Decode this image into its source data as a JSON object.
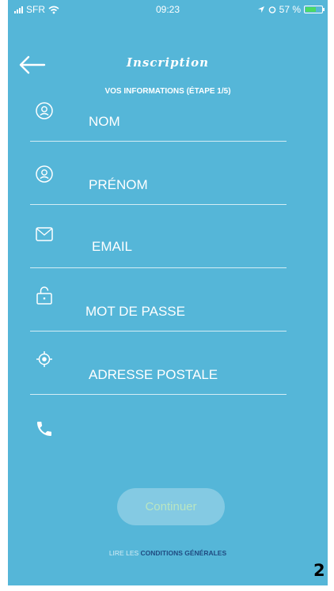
{
  "status_bar": {
    "carrier": "SFR",
    "time": "09:23",
    "battery": "57 %",
    "battery_level": 0.57
  },
  "header": {
    "title": "Inscription",
    "subtitle": "VOS INFORMATIONS (ÉTAPE 1/5)"
  },
  "fields": [
    {
      "label": "NOM",
      "icon": "user-circle-icon"
    },
    {
      "label": "PRÉNOM",
      "icon": "user-circle-icon"
    },
    {
      "label": "EMAIL",
      "icon": "envelope-icon"
    },
    {
      "label": "MOT DE PASSE",
      "icon": "lock-icon"
    },
    {
      "label": "ADRESSE POSTALE",
      "icon": "location-target-icon"
    }
  ],
  "phone_field": {
    "icon": "phone-icon"
  },
  "actions": {
    "continue_label": "Continuer"
  },
  "footer": {
    "lire_les": "LIRE LES",
    "conditions": "CONDITIONS GÉNÉRALES"
  },
  "page_number": "2",
  "colors": {
    "background": "#55b6d8",
    "link": "#1f4a80",
    "button_text": "#b9e6c2"
  }
}
